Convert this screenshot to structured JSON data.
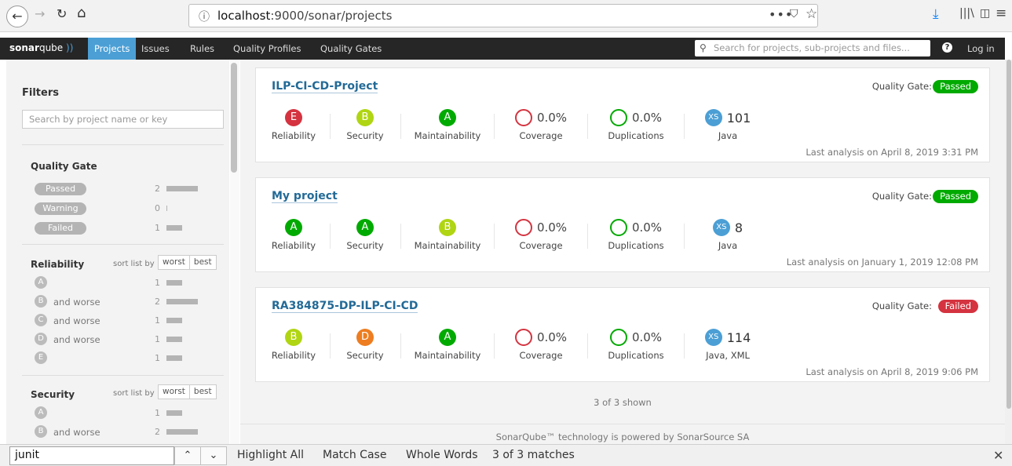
{
  "browser": {
    "url_host": "localhost",
    "url_path": ":9000/sonar/projects",
    "info_icon": "ⓘ",
    "dots": "•••"
  },
  "nav": {
    "logo_bold": "sonar",
    "logo_rest": "qube",
    "items": [
      "Projects",
      "Issues",
      "Rules",
      "Quality Profiles",
      "Quality Gates"
    ],
    "search_placeholder": "Search for projects, sub-projects and files...",
    "help": "?",
    "login": "Log in"
  },
  "filters": {
    "title": "Filters",
    "search_placeholder": "Search by project name or key",
    "quality_gate": {
      "title": "Quality Gate",
      "items": [
        {
          "label": "Passed",
          "count": "2",
          "bar": 0.5
        },
        {
          "label": "Warning",
          "count": "0",
          "bar": 0
        },
        {
          "label": "Failed",
          "count": "1",
          "bar": 0.25
        }
      ]
    },
    "sort_list_by": "sort list by",
    "sort_worst": "worst",
    "sort_best": "best",
    "and_worse": "and worse",
    "reliability": {
      "title": "Reliability",
      "items": [
        {
          "grade": "A",
          "count": "1"
        },
        {
          "grade": "B",
          "count": "2"
        },
        {
          "grade": "C",
          "count": "1"
        },
        {
          "grade": "D",
          "count": "1"
        },
        {
          "grade": "E",
          "count": "1"
        }
      ]
    },
    "security": {
      "title": "Security",
      "items": [
        {
          "grade": "A",
          "count": "1"
        },
        {
          "grade": "B",
          "count": "2"
        }
      ]
    }
  },
  "metric_labels": {
    "reliability": "Reliability",
    "security": "Security",
    "maintainability": "Maintainability",
    "coverage": "Coverage",
    "duplications": "Duplications"
  },
  "projects": [
    {
      "name": "ILP-CI-CD-Project",
      "qg_label": "Quality Gate:",
      "qg_status": "Passed",
      "reliability": "E",
      "security": "B",
      "maintainability": "A",
      "coverage": "0.0%",
      "duplications": "0.0%",
      "size": "XS",
      "loc": "101",
      "languages": "Java",
      "last_analysis": "Last analysis on April 8, 2019 3:31 PM"
    },
    {
      "name": "My project",
      "qg_label": "Quality Gate:",
      "qg_status": "Passed",
      "reliability": "A",
      "security": "A",
      "maintainability": "B",
      "coverage": "0.0%",
      "duplications": "0.0%",
      "size": "XS",
      "loc": "8",
      "languages": "Java",
      "last_analysis": "Last analysis on January 1, 2019 12:08 PM"
    },
    {
      "name": "RA384875-DP-ILP-CI-CD",
      "qg_label": "Quality Gate:",
      "qg_status": "Failed",
      "reliability": "B",
      "security": "D",
      "maintainability": "A",
      "coverage": "0.0%",
      "duplications": "0.0%",
      "size": "XS",
      "loc": "114",
      "languages": "Java, XML",
      "last_analysis": "Last analysis on April 8, 2019 9:06 PM"
    }
  ],
  "shown": "3 of 3 shown",
  "footer": "SonarQube™ technology is powered by SonarSource SA",
  "findbar": {
    "query": "junit",
    "highlight_all": "Highlight All",
    "match_case": "Match Case",
    "whole_words": "Whole Words",
    "matches": "3 of 3 matches"
  }
}
